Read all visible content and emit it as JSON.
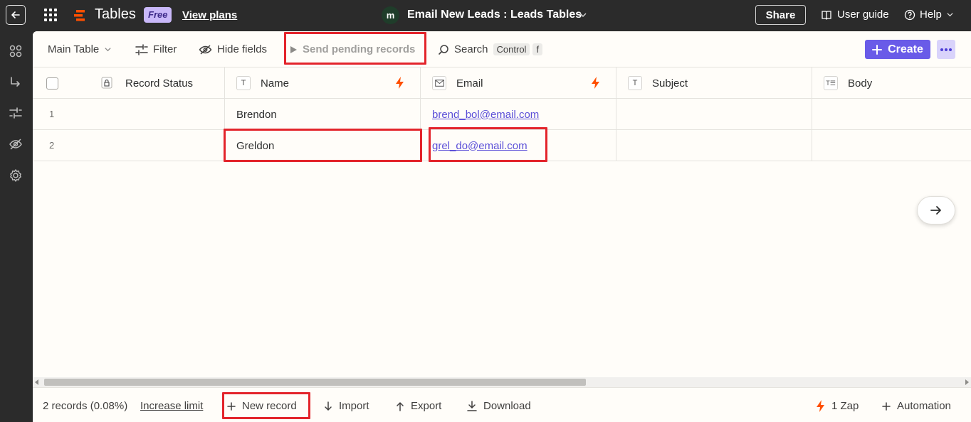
{
  "topbar": {
    "app_name": "Tables",
    "plan_badge": "Free",
    "view_plans": "View plans",
    "avatar_letter": "m",
    "zap_title": "Email New Leads : Leads Tables",
    "share": "Share",
    "user_guide": "User guide",
    "help": "Help"
  },
  "toolbar": {
    "table_selector": "Main Table",
    "filter": "Filter",
    "hide_fields": "Hide fields",
    "send_pending": "Send pending records",
    "search": "Search",
    "search_shortcut_key1": "Control",
    "search_shortcut_key2": "f",
    "create": "Create"
  },
  "columns": [
    {
      "label": "Record Status",
      "type_icon": "lock-icon"
    },
    {
      "label": "Name",
      "type_icon": "text-type-icon",
      "type_glyph": "T"
    },
    {
      "label": "Email",
      "type_icon": "email-type-icon"
    },
    {
      "label": "Subject",
      "type_icon": "text-type-icon",
      "type_glyph": "T"
    },
    {
      "label": "Body",
      "type_icon": "long-text-type-icon",
      "type_glyph": "T☰"
    }
  ],
  "rows": [
    {
      "num": "1",
      "name": "Brendon",
      "email": "brend_bol@email.com",
      "subject": "",
      "body": ""
    },
    {
      "num": "2",
      "name": "Greldon",
      "email": "grel_do@email.com",
      "subject": "",
      "body": ""
    }
  ],
  "footer": {
    "record_count": "2 records (0.08%)",
    "increase_limit": "Increase limit",
    "new_record": "New record",
    "import": "Import",
    "export": "Export",
    "download": "Download",
    "zap_count": "1 Zap",
    "automation": "Automation"
  },
  "colors": {
    "accent": "#695be8",
    "zap_orange": "#ff4f00",
    "highlight": "#e3242b",
    "topbar_bg": "#2b2b2b"
  }
}
